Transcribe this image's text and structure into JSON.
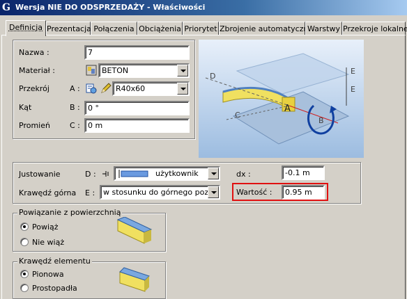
{
  "window": {
    "title": "Wersja NIE DO ODSPRZEDAŻY - Właściwości",
    "app_icon": "G"
  },
  "tabs": [
    {
      "label": "Definicja",
      "active": true
    },
    {
      "label": "Prezentacja"
    },
    {
      "label": "Połączenia"
    },
    {
      "label": "Obciążenia"
    },
    {
      "label": "Priorytet"
    },
    {
      "label": "Zbrojenie automatyczne"
    },
    {
      "label": "Warstwy"
    },
    {
      "label": "Przekroje lokalne"
    }
  ],
  "definition": {
    "nazwa": {
      "label": "Nazwa :",
      "value": "7"
    },
    "material": {
      "label": "Materiał :",
      "value": "BETON",
      "icon": "material-icon"
    },
    "przekroj": {
      "label": "Przekrój",
      "letter": "A :",
      "value": "R40x60",
      "icons": [
        "section-icon",
        "pencil-icon"
      ]
    },
    "kat": {
      "label": "Kąt",
      "letter": "B :",
      "value": "0 °"
    },
    "promien": {
      "label": "Promień",
      "letter": "C :",
      "value": "0 m"
    }
  },
  "preview": {
    "labels": {
      "d": "D",
      "e1": "E",
      "e2": "E",
      "a": "A",
      "b": "B",
      "c": "C"
    }
  },
  "alignment": {
    "justowanie": {
      "label": "Justowanie",
      "letter": "D :",
      "value": "użytkownik",
      "icon": "alignment-icon"
    },
    "krawedz_gorna": {
      "label": "Krawędź górna",
      "letter": "E :",
      "value": "w stosunku do górnego poziomu"
    },
    "dx": {
      "label": "dx :",
      "value": "-0.1 m"
    },
    "wartosc": {
      "label": "Wartość :",
      "value": "0.95 m"
    }
  },
  "surface_link": {
    "legend": "Powiązanie z powierzchnią",
    "options": [
      {
        "label": "Powiąż",
        "checked": true
      },
      {
        "label": "Nie wiąż",
        "checked": false
      }
    ]
  },
  "element_edge": {
    "legend": "Krawędź elementu",
    "options": [
      {
        "label": "Pionowa",
        "checked": true
      },
      {
        "label": "Prostopadła",
        "checked": false
      }
    ]
  },
  "colors": {
    "highlight": "#e01010",
    "beam": "#f0e060",
    "preview_bg": "#c8dcf0"
  }
}
